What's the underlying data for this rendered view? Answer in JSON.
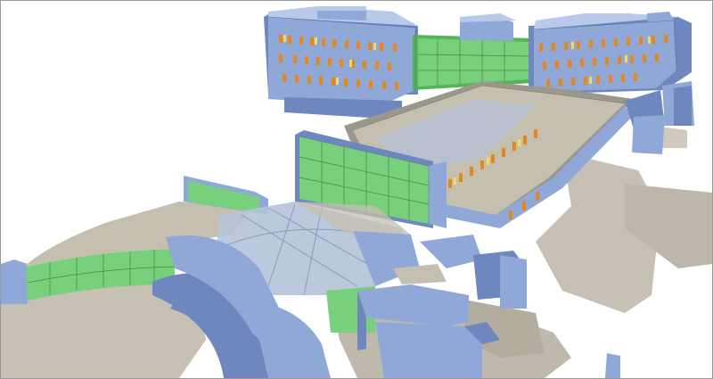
{
  "scene": {
    "subject": "",
    "colors": {
      "background": "#ffffff",
      "frame": "#9a9a9a",
      "ground": "#c6c0b5",
      "ground_dark": "#aca596",
      "wall": "#8fa8d8",
      "wall_dark": "#6e88bf",
      "wall_light": "#b9c9ea",
      "roof": "#c5bfb0",
      "roof_dark": "#9c978b",
      "glazing": "#79d07c",
      "glazing_dark": "#55b45a",
      "glass": "#b5c3d8",
      "window_orange": "#e6861f",
      "window_yellow": "#f2de5c",
      "outline": "#3d4e70"
    }
  }
}
